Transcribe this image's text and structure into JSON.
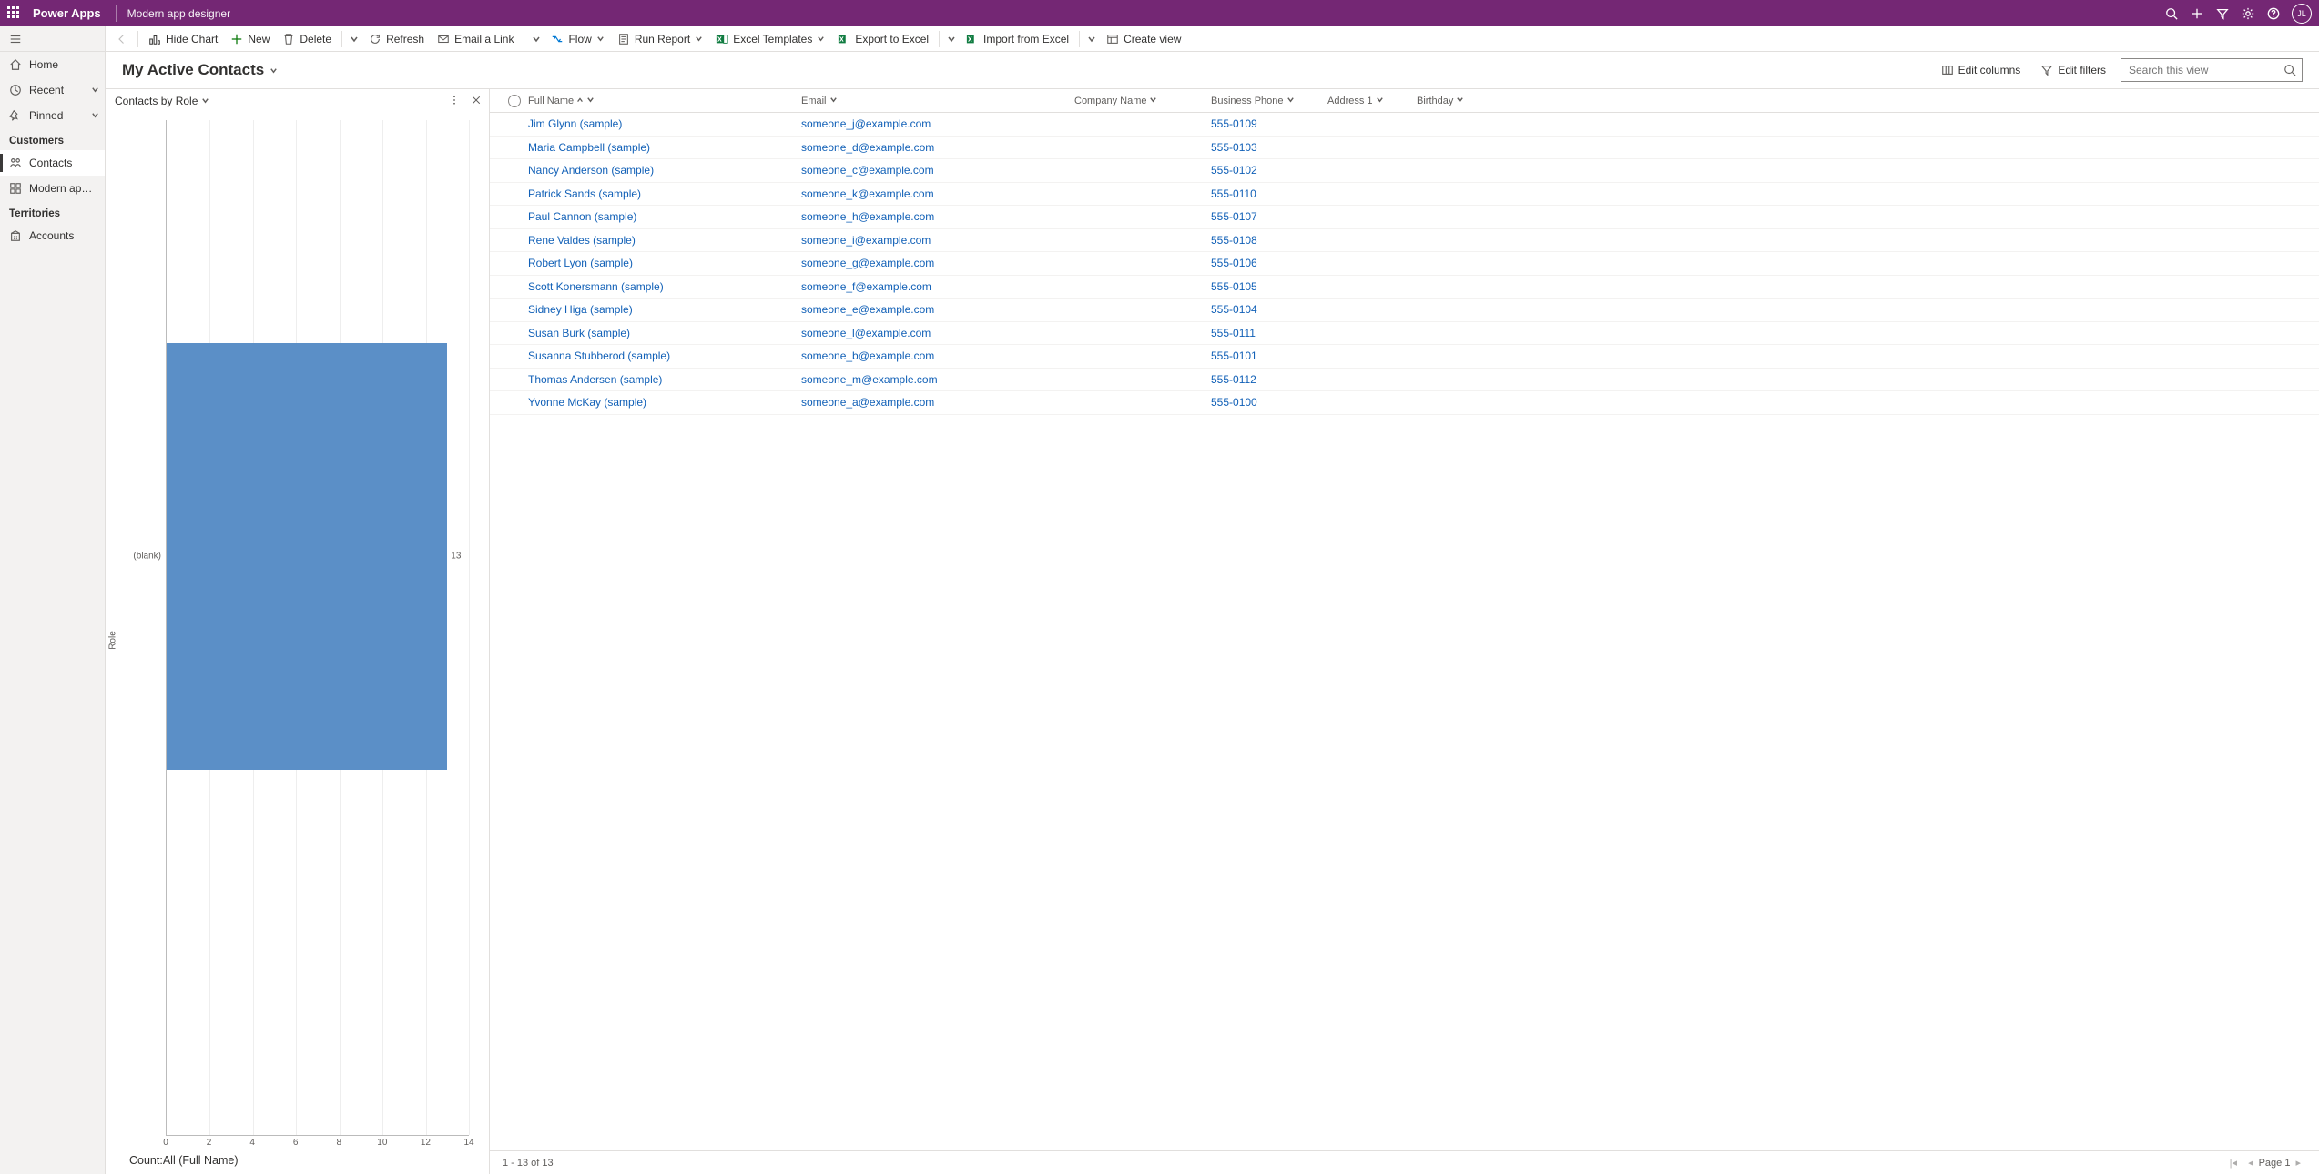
{
  "topbar": {
    "brand": "Power Apps",
    "subtitle": "Modern app designer",
    "avatar": "JL"
  },
  "nav": {
    "home": "Home",
    "recent": "Recent",
    "pinned": "Pinned",
    "section_customers": "Customers",
    "contacts": "Contacts",
    "modern_app": "Modern app designe...",
    "section_territories": "Territories",
    "accounts": "Accounts"
  },
  "commands": {
    "hide_chart": "Hide Chart",
    "new": "New",
    "delete": "Delete",
    "refresh": "Refresh",
    "email_link": "Email a Link",
    "flow": "Flow",
    "run_report": "Run Report",
    "excel_templates": "Excel Templates",
    "export_excel": "Export to Excel",
    "import_excel": "Import from Excel",
    "create_view": "Create view"
  },
  "view": {
    "title": "My Active Contacts",
    "edit_columns": "Edit columns",
    "edit_filters": "Edit filters",
    "search_placeholder": "Search this view"
  },
  "chart": {
    "title": "Contacts by Role"
  },
  "chart_data": {
    "type": "bar",
    "orientation": "horizontal",
    "categories": [
      "(blank)"
    ],
    "values": [
      13
    ],
    "xlabel": "Count:All (Full Name)",
    "ylabel": "Role",
    "xlim": [
      0,
      14
    ],
    "xticks": [
      0,
      2,
      4,
      6,
      8,
      10,
      12,
      14
    ]
  },
  "columns": {
    "full_name": "Full Name",
    "email": "Email",
    "company": "Company Name",
    "phone": "Business Phone",
    "address": "Address 1",
    "birthday": "Birthday"
  },
  "rows": [
    {
      "name": "Jim Glynn (sample)",
      "email": "someone_j@example.com",
      "company": "",
      "phone": "555-0109",
      "address": "",
      "birthday": ""
    },
    {
      "name": "Maria Campbell (sample)",
      "email": "someone_d@example.com",
      "company": "",
      "phone": "555-0103",
      "address": "",
      "birthday": ""
    },
    {
      "name": "Nancy Anderson (sample)",
      "email": "someone_c@example.com",
      "company": "",
      "phone": "555-0102",
      "address": "",
      "birthday": ""
    },
    {
      "name": "Patrick Sands (sample)",
      "email": "someone_k@example.com",
      "company": "",
      "phone": "555-0110",
      "address": "",
      "birthday": ""
    },
    {
      "name": "Paul Cannon (sample)",
      "email": "someone_h@example.com",
      "company": "",
      "phone": "555-0107",
      "address": "",
      "birthday": ""
    },
    {
      "name": "Rene Valdes (sample)",
      "email": "someone_i@example.com",
      "company": "",
      "phone": "555-0108",
      "address": "",
      "birthday": ""
    },
    {
      "name": "Robert Lyon (sample)",
      "email": "someone_g@example.com",
      "company": "",
      "phone": "555-0106",
      "address": "",
      "birthday": ""
    },
    {
      "name": "Scott Konersmann (sample)",
      "email": "someone_f@example.com",
      "company": "",
      "phone": "555-0105",
      "address": "",
      "birthday": ""
    },
    {
      "name": "Sidney Higa (sample)",
      "email": "someone_e@example.com",
      "company": "",
      "phone": "555-0104",
      "address": "",
      "birthday": ""
    },
    {
      "name": "Susan Burk (sample)",
      "email": "someone_l@example.com",
      "company": "",
      "phone": "555-0111",
      "address": "",
      "birthday": ""
    },
    {
      "name": "Susanna Stubberod (sample)",
      "email": "someone_b@example.com",
      "company": "",
      "phone": "555-0101",
      "address": "",
      "birthday": ""
    },
    {
      "name": "Thomas Andersen (sample)",
      "email": "someone_m@example.com",
      "company": "",
      "phone": "555-0112",
      "address": "",
      "birthday": ""
    },
    {
      "name": "Yvonne McKay (sample)",
      "email": "someone_a@example.com",
      "company": "",
      "phone": "555-0100",
      "address": "",
      "birthday": ""
    }
  ],
  "footer": {
    "range": "1 - 13 of 13",
    "page": "Page 1"
  }
}
